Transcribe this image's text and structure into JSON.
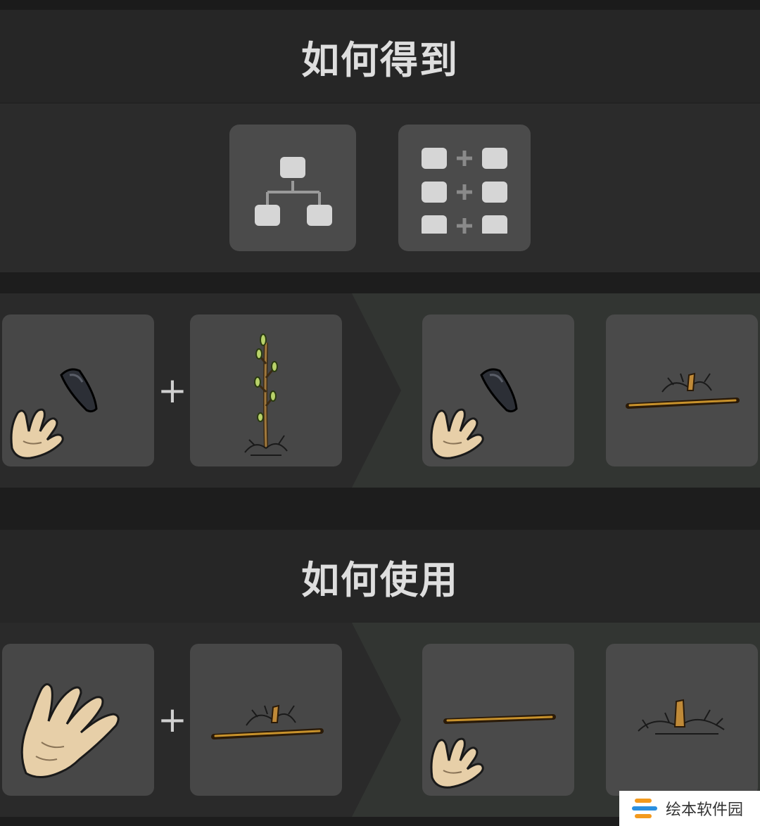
{
  "sections": {
    "obtain": {
      "title": "如何得到"
    },
    "use": {
      "title": "如何使用"
    }
  },
  "methods": [
    {
      "icon": "tech-tree-icon"
    },
    {
      "icon": "crafting-grid-icon"
    }
  ],
  "recipes": {
    "obtain": {
      "operator": "+",
      "inputs": [
        "sharp-stone-in-hand",
        "sapling"
      ],
      "outputs": [
        "sharp-stone-in-hand",
        "long-straight-shaft-on-sapling-stub"
      ]
    },
    "use": {
      "operator": "+",
      "inputs": [
        "empty-hand",
        "long-straight-shaft-on-sapling-stub"
      ],
      "outputs": [
        "long-straight-shaft-in-hand",
        "sapling-stub"
      ]
    }
  },
  "watermark": {
    "text": "绘本软件园"
  },
  "colors": {
    "background": "#1d1d1d",
    "header": "#262626",
    "slot": "#474747",
    "result_area": "#323532",
    "title_text": "#dedede"
  }
}
